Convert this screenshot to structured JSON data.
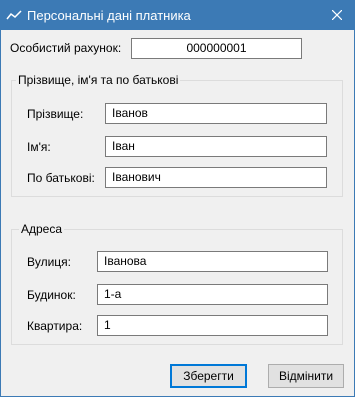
{
  "window": {
    "title": "Персональні дані платника",
    "icon": "chart-line-icon",
    "close_icon": "close-icon",
    "accent_color": "#3c7ab5"
  },
  "account": {
    "label": "Особистий рахунок:",
    "value": "000000001"
  },
  "name_group": {
    "legend": "Прізвище, ім'я та по батькові",
    "fields": [
      {
        "label": "Прізвище:",
        "value": "Іванов"
      },
      {
        "label": "Ім'я:",
        "value": "Іван"
      },
      {
        "label": "По батькові:",
        "value": "Іванович"
      }
    ]
  },
  "address_group": {
    "legend": "Адреса",
    "fields": [
      {
        "label": "Вулиця:",
        "value": "Іванова"
      },
      {
        "label": "Будинок:",
        "value": "1-а"
      },
      {
        "label": "Квартира:",
        "value": "1"
      }
    ]
  },
  "buttons": {
    "save": "Зберегти",
    "cancel": "Відмінити"
  }
}
